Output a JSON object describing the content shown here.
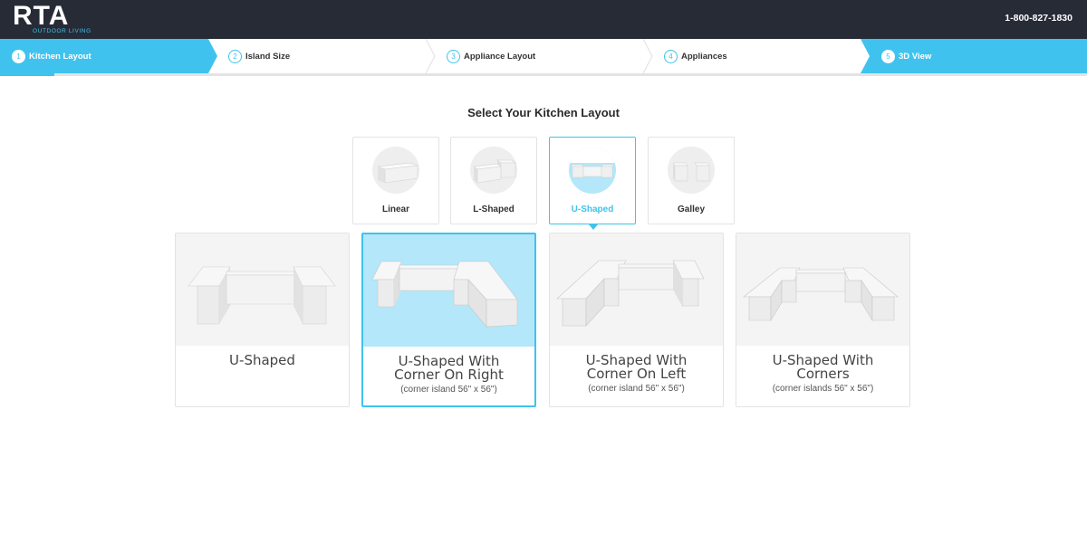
{
  "header": {
    "logo_text": "RTA",
    "logo_subtext": "OUTDOOR LIVING",
    "phone": "1-800-827-1830"
  },
  "steps": [
    {
      "num": "1",
      "label": "Kitchen Layout",
      "state": "active"
    },
    {
      "num": "2",
      "label": "Island Size",
      "state": "inactive"
    },
    {
      "num": "3",
      "label": "Appliance Layout",
      "state": "inactive"
    },
    {
      "num": "4",
      "label": "Appliances",
      "state": "inactive"
    },
    {
      "num": "5",
      "label": "3D View",
      "state": "active"
    }
  ],
  "main": {
    "heading": "Select Your Kitchen Layout",
    "layout_types": [
      {
        "label": "Linear",
        "icon": "linear-island-icon",
        "selected": false
      },
      {
        "label": "L-Shaped",
        "icon": "l-shaped-island-icon",
        "selected": false
      },
      {
        "label": "U-Shaped",
        "icon": "u-shaped-island-icon",
        "selected": true
      },
      {
        "label": "Galley",
        "icon": "galley-island-icon",
        "selected": false
      }
    ],
    "options": [
      {
        "title_line1": "U-Shaped",
        "title_line2": "",
        "subtitle": "",
        "selected": false
      },
      {
        "title_line1": "U-Shaped With",
        "title_line2": "Corner On Right",
        "subtitle": "(corner island 56\" x 56\")",
        "selected": true
      },
      {
        "title_line1": "U-Shaped With",
        "title_line2": "Corner On Left",
        "subtitle": "(corner island 56\" x 56\")",
        "selected": false
      },
      {
        "title_line1": "U-Shaped With",
        "title_line2": "Corners",
        "subtitle": "(corner islands 56\" x 56\")",
        "selected": false
      }
    ]
  },
  "colors": {
    "accent": "#3fc3ee",
    "header_bg": "#262b36",
    "selected_fill": "#b3e7f9"
  }
}
